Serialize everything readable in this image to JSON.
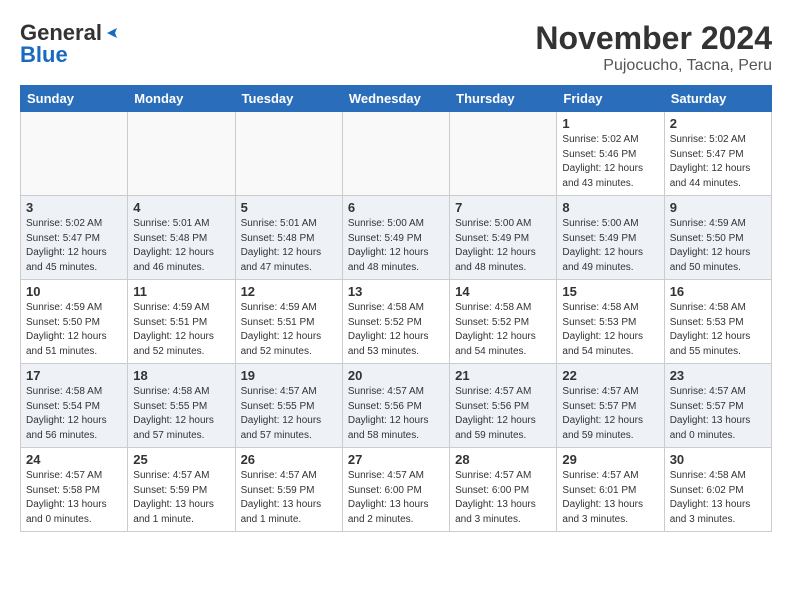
{
  "header": {
    "logo_general": "General",
    "logo_blue": "Blue",
    "month_title": "November 2024",
    "location": "Pujocucho, Tacna, Peru"
  },
  "days_of_week": [
    "Sunday",
    "Monday",
    "Tuesday",
    "Wednesday",
    "Thursday",
    "Friday",
    "Saturday"
  ],
  "weeks": [
    [
      {
        "day": "",
        "info": ""
      },
      {
        "day": "",
        "info": ""
      },
      {
        "day": "",
        "info": ""
      },
      {
        "day": "",
        "info": ""
      },
      {
        "day": "",
        "info": ""
      },
      {
        "day": "1",
        "info": "Sunrise: 5:02 AM\nSunset: 5:46 PM\nDaylight: 12 hours\nand 43 minutes."
      },
      {
        "day": "2",
        "info": "Sunrise: 5:02 AM\nSunset: 5:47 PM\nDaylight: 12 hours\nand 44 minutes."
      }
    ],
    [
      {
        "day": "3",
        "info": "Sunrise: 5:02 AM\nSunset: 5:47 PM\nDaylight: 12 hours\nand 45 minutes."
      },
      {
        "day": "4",
        "info": "Sunrise: 5:01 AM\nSunset: 5:48 PM\nDaylight: 12 hours\nand 46 minutes."
      },
      {
        "day": "5",
        "info": "Sunrise: 5:01 AM\nSunset: 5:48 PM\nDaylight: 12 hours\nand 47 minutes."
      },
      {
        "day": "6",
        "info": "Sunrise: 5:00 AM\nSunset: 5:49 PM\nDaylight: 12 hours\nand 48 minutes."
      },
      {
        "day": "7",
        "info": "Sunrise: 5:00 AM\nSunset: 5:49 PM\nDaylight: 12 hours\nand 48 minutes."
      },
      {
        "day": "8",
        "info": "Sunrise: 5:00 AM\nSunset: 5:49 PM\nDaylight: 12 hours\nand 49 minutes."
      },
      {
        "day": "9",
        "info": "Sunrise: 4:59 AM\nSunset: 5:50 PM\nDaylight: 12 hours\nand 50 minutes."
      }
    ],
    [
      {
        "day": "10",
        "info": "Sunrise: 4:59 AM\nSunset: 5:50 PM\nDaylight: 12 hours\nand 51 minutes."
      },
      {
        "day": "11",
        "info": "Sunrise: 4:59 AM\nSunset: 5:51 PM\nDaylight: 12 hours\nand 52 minutes."
      },
      {
        "day": "12",
        "info": "Sunrise: 4:59 AM\nSunset: 5:51 PM\nDaylight: 12 hours\nand 52 minutes."
      },
      {
        "day": "13",
        "info": "Sunrise: 4:58 AM\nSunset: 5:52 PM\nDaylight: 12 hours\nand 53 minutes."
      },
      {
        "day": "14",
        "info": "Sunrise: 4:58 AM\nSunset: 5:52 PM\nDaylight: 12 hours\nand 54 minutes."
      },
      {
        "day": "15",
        "info": "Sunrise: 4:58 AM\nSunset: 5:53 PM\nDaylight: 12 hours\nand 54 minutes."
      },
      {
        "day": "16",
        "info": "Sunrise: 4:58 AM\nSunset: 5:53 PM\nDaylight: 12 hours\nand 55 minutes."
      }
    ],
    [
      {
        "day": "17",
        "info": "Sunrise: 4:58 AM\nSunset: 5:54 PM\nDaylight: 12 hours\nand 56 minutes."
      },
      {
        "day": "18",
        "info": "Sunrise: 4:58 AM\nSunset: 5:55 PM\nDaylight: 12 hours\nand 57 minutes."
      },
      {
        "day": "19",
        "info": "Sunrise: 4:57 AM\nSunset: 5:55 PM\nDaylight: 12 hours\nand 57 minutes."
      },
      {
        "day": "20",
        "info": "Sunrise: 4:57 AM\nSunset: 5:56 PM\nDaylight: 12 hours\nand 58 minutes."
      },
      {
        "day": "21",
        "info": "Sunrise: 4:57 AM\nSunset: 5:56 PM\nDaylight: 12 hours\nand 59 minutes."
      },
      {
        "day": "22",
        "info": "Sunrise: 4:57 AM\nSunset: 5:57 PM\nDaylight: 12 hours\nand 59 minutes."
      },
      {
        "day": "23",
        "info": "Sunrise: 4:57 AM\nSunset: 5:57 PM\nDaylight: 13 hours\nand 0 minutes."
      }
    ],
    [
      {
        "day": "24",
        "info": "Sunrise: 4:57 AM\nSunset: 5:58 PM\nDaylight: 13 hours\nand 0 minutes."
      },
      {
        "day": "25",
        "info": "Sunrise: 4:57 AM\nSunset: 5:59 PM\nDaylight: 13 hours\nand 1 minute."
      },
      {
        "day": "26",
        "info": "Sunrise: 4:57 AM\nSunset: 5:59 PM\nDaylight: 13 hours\nand 1 minute."
      },
      {
        "day": "27",
        "info": "Sunrise: 4:57 AM\nSunset: 6:00 PM\nDaylight: 13 hours\nand 2 minutes."
      },
      {
        "day": "28",
        "info": "Sunrise: 4:57 AM\nSunset: 6:00 PM\nDaylight: 13 hours\nand 3 minutes."
      },
      {
        "day": "29",
        "info": "Sunrise: 4:57 AM\nSunset: 6:01 PM\nDaylight: 13 hours\nand 3 minutes."
      },
      {
        "day": "30",
        "info": "Sunrise: 4:58 AM\nSunset: 6:02 PM\nDaylight: 13 hours\nand 3 minutes."
      }
    ]
  ]
}
